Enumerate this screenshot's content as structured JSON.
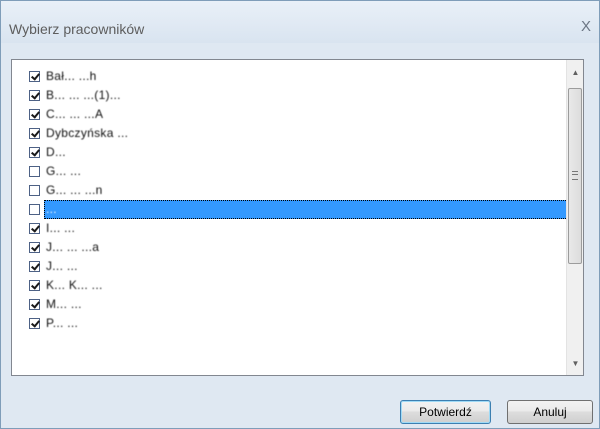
{
  "dialog": {
    "title": "Wybierz pracowników",
    "close_glyph": "X"
  },
  "employees": [
    {
      "name": "Bał... ...h",
      "checked": true
    },
    {
      "name": "B... ... ...(1)...",
      "checked": true
    },
    {
      "name": "C... ... ...A",
      "checked": true
    },
    {
      "name": "Dybczyńska ...",
      "checked": true
    },
    {
      "name": "D...",
      "checked": true
    },
    {
      "name": "G... ...",
      "checked": false
    },
    {
      "name": "G... ... ...n",
      "checked": false
    },
    {
      "name": "...",
      "checked": false,
      "selected": true
    },
    {
      "name": "I... ...",
      "checked": true
    },
    {
      "name": "J... ... ...a",
      "checked": true
    },
    {
      "name": "J... ...",
      "checked": true
    },
    {
      "name": "K... K... ...",
      "checked": true
    },
    {
      "name": "M... ...",
      "checked": true
    },
    {
      "name": "P... ...",
      "checked": true
    }
  ],
  "scrollbar": {
    "up_icon": "▲",
    "down_icon": "▼"
  },
  "buttons": {
    "confirm": "Potwierdź",
    "cancel": "Anuluj"
  }
}
